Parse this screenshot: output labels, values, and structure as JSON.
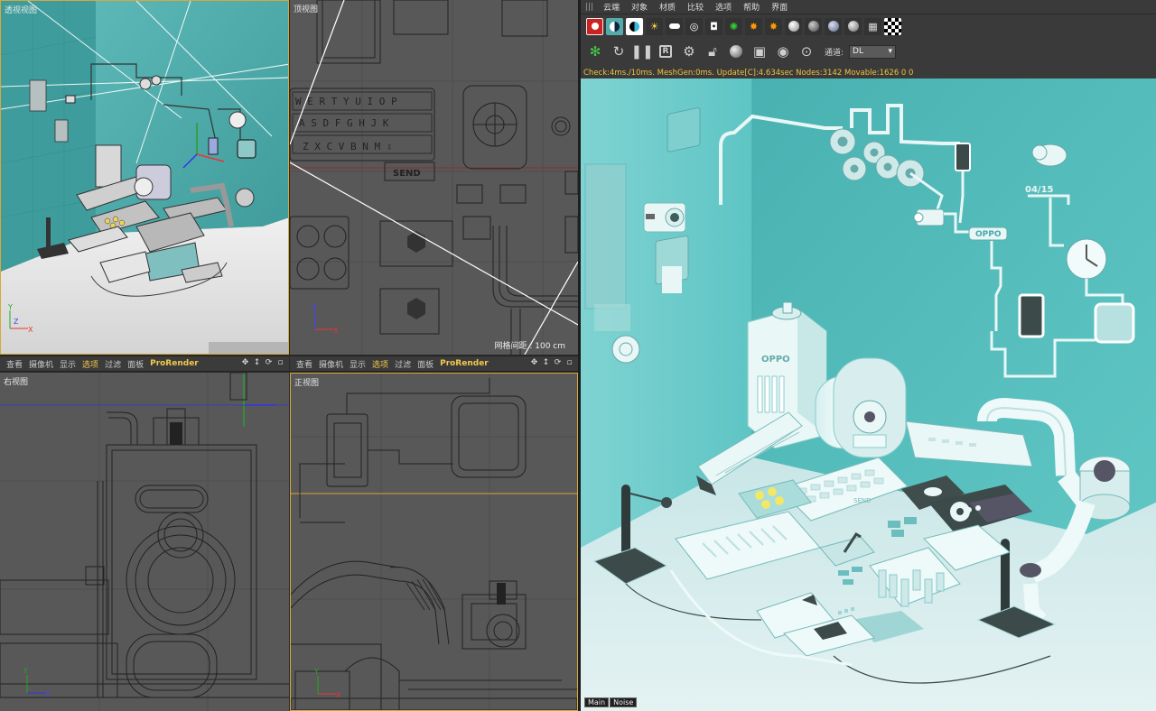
{
  "viewports": {
    "perspective": {
      "label": "透视视图"
    },
    "top": {
      "label": "顶视图",
      "grid_scale": "网格间距 : 100 cm",
      "keyboard_send": "SEND"
    },
    "right": {
      "label": "右视图"
    },
    "front": {
      "label": "正视图"
    }
  },
  "viewport_toolbar": {
    "items": [
      "查看",
      "摄像机",
      "显示",
      "选项",
      "过滤",
      "面板",
      "ProRender"
    ]
  },
  "render_panel": {
    "menu": [
      "云端",
      "对象",
      "材质",
      "比较",
      "选项",
      "帮助",
      "界面"
    ],
    "channel_label": "通道:",
    "channel_value": "DL",
    "status": "Check:4ms./10ms. MeshGen:0ms. Update[C]:4.634sec Nodes:3142 Movable:1626  0 0",
    "bottom_tabs": [
      "Main",
      "Noise"
    ]
  },
  "scene": {
    "brand_text": "OPPO",
    "date_text": "04/15",
    "send_key": "SEND"
  },
  "colors": {
    "accent": "#f2c94c",
    "wall": "#5fc6c4",
    "floor": "#cfe9ea",
    "viewport_bg": "#585858"
  }
}
